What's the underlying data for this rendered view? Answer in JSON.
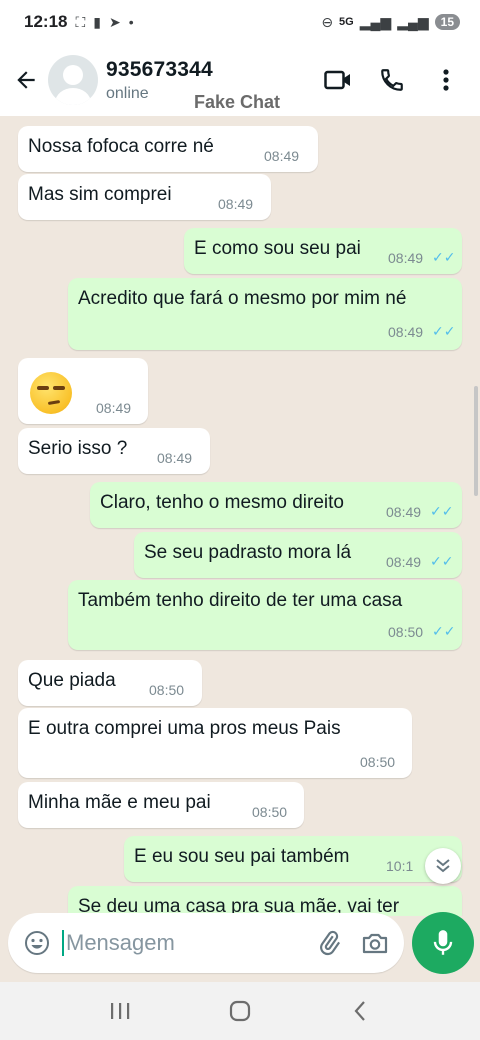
{
  "status_bar": {
    "time": "12:18",
    "network": "5G",
    "battery": "15"
  },
  "header": {
    "contact_name": "935673344",
    "contact_status": "online",
    "watermark": "Fake Chat"
  },
  "messages": [
    {
      "dir": "in",
      "text": "Nossa fofoca corre né",
      "time": "08:49"
    },
    {
      "dir": "in",
      "text": "Mas sim comprei",
      "time": "08:49"
    },
    {
      "dir": "out",
      "text": "E como sou seu pai",
      "time": "08:49",
      "read": true
    },
    {
      "dir": "out",
      "text": "Acredito que fará o mesmo por mim né",
      "time": "08:49",
      "read": true
    },
    {
      "dir": "in",
      "emoji": "unamused-face",
      "time": "08:49"
    },
    {
      "dir": "in",
      "text": "Serio isso ?",
      "time": "08:49"
    },
    {
      "dir": "out",
      "text": "Claro, tenho o mesmo direito",
      "time": "08:49",
      "read": true
    },
    {
      "dir": "out",
      "text": "Se seu padrasto mora lá",
      "time": "08:49",
      "read": true
    },
    {
      "dir": "out",
      "text": "Também tenho direito de ter uma casa",
      "time": "08:50",
      "read": true
    },
    {
      "dir": "in",
      "text": "Que piada",
      "time": "08:50"
    },
    {
      "dir": "in",
      "text": "E outra comprei uma pros meus Pais",
      "time": "08:50"
    },
    {
      "dir": "in",
      "text": "Minha mãe e meu pai",
      "time": "08:50"
    },
    {
      "dir": "out",
      "text": "E eu sou seu pai também",
      "time": "10:1"
    },
    {
      "dir": "out",
      "text": "Se deu uma casa pra sua mãe, vai ter"
    }
  ],
  "composer": {
    "placeholder": "Mensagem"
  },
  "colors": {
    "accent": "#1daa61",
    "chat_bg": "#efe7de",
    "outgoing_bubble": "#d9fdd3",
    "incoming_bubble": "#ffffff",
    "read_ticks": "#53bdeb"
  },
  "icons": {
    "back": "arrow-left-icon",
    "video": "video-camera-icon",
    "call": "phone-icon",
    "menu": "more-vertical-icon",
    "emoji": "emoji-icon",
    "attach": "paperclip-icon",
    "camera": "camera-icon",
    "mic": "microphone-icon",
    "scroll_down": "chevron-double-down-icon"
  }
}
